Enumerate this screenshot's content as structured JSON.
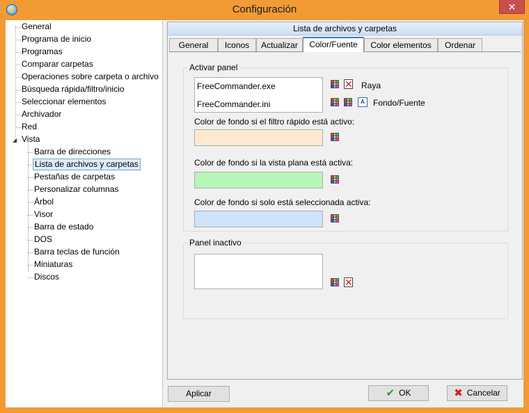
{
  "window": {
    "title": "Configuración"
  },
  "tree": {
    "top_items": [
      "General",
      "Programa de inicio",
      "Programas",
      "Comparar carpetas",
      "Operaciones sobre carpeta o archivo",
      "Búsqueda rápida/filtro/inicio",
      "Seleccionar elementos",
      "Archivador",
      "Red",
      "Vista"
    ],
    "vista_children": [
      "Barra de direcciones",
      "Lista de archivos y carpetas",
      "Pestañas de carpetas",
      "Personalizar columnas",
      "Árbol",
      "Visor",
      "Barra de estado",
      "DOS",
      "Barra teclas de función",
      "Miniaturas",
      "Discos"
    ],
    "selected": "Lista de archivos y carpetas"
  },
  "panel": {
    "header": "Lista de archivos y carpetas",
    "tabs": [
      "General",
      "Iconos",
      "Actualizar",
      "Color/Fuente",
      "Color elementos",
      "Ordenar"
    ],
    "active_tab": "Color/Fuente"
  },
  "active_panel": {
    "title": "Activar panel",
    "list_items": [
      "FreeCommander.exe",
      "FreeCommander.ini"
    ],
    "raya_label": "Raya",
    "font_label": "Fondo/Fuente",
    "quick_filter_label": "Color de fondo si el filtro rápido está activo:",
    "quick_filter_color": "#fde9d0",
    "flat_view_label": "Color de fondo si la vista plana está activa:",
    "flat_view_color": "#b8f5b8",
    "only_selected_label": "Color de fondo si solo está seleccionada activa:",
    "only_selected_color": "#cfe3f9"
  },
  "inactive_panel": {
    "title": "Panel inactivo"
  },
  "buttons": {
    "apply": "Aplicar",
    "ok": "OK",
    "cancel": "Cancelar"
  },
  "colors": {
    "accent": "#f29b35",
    "check": "#2e9a2e",
    "cross": "#d41b1b"
  }
}
